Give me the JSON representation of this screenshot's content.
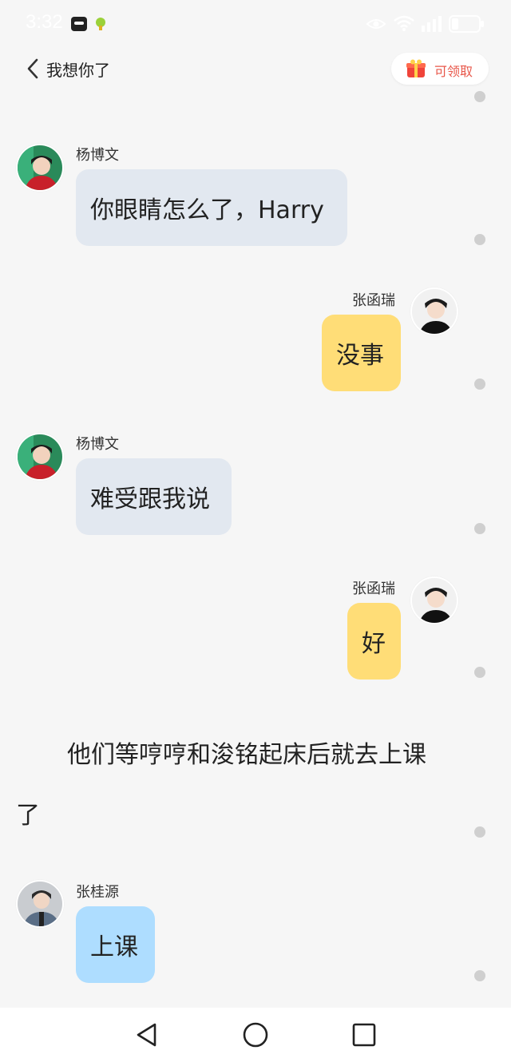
{
  "status_bar": {
    "time": "3:32",
    "icons": [
      "app-icon-1",
      "app-icon-2",
      "eye-icon",
      "wifi-icon",
      "signal-icon",
      "battery-icon"
    ]
  },
  "header": {
    "title": "我想你了",
    "reward_label": "可领取"
  },
  "messages": [
    {
      "side": "left",
      "sender": "杨博文",
      "text": "你眼睛怎么了，Harry",
      "bubble_color": "#e2e8f0"
    },
    {
      "side": "right",
      "sender": "张函瑞",
      "text": "没事",
      "bubble_color": "#ffdd77"
    },
    {
      "side": "left",
      "sender": "杨博文",
      "text": "难受跟我说",
      "bubble_color": "#e2e8f0"
    },
    {
      "side": "right",
      "sender": "张函瑞",
      "text": "好",
      "bubble_color": "#ffdd77"
    },
    {
      "side": "narration",
      "line1": "他们等哼哼和浚铭起床后就去上课",
      "line2": "了"
    },
    {
      "side": "left",
      "sender": "张桂源",
      "text": "上课",
      "bubble_color": "#aeddff"
    }
  ],
  "nav": [
    "back-nav",
    "home-nav",
    "recents-nav"
  ]
}
